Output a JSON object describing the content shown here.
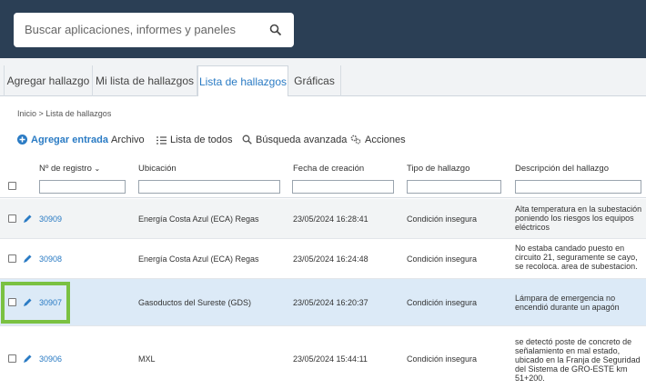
{
  "search": {
    "placeholder": "Buscar aplicaciones, informes y paneles",
    "icon": "search-icon"
  },
  "tabs": [
    {
      "label": "Agregar hallazgo",
      "active": false
    },
    {
      "label": "Mi lista de hallazgos",
      "active": false
    },
    {
      "label": "Lista de hallazgos",
      "active": true
    },
    {
      "label": "Gráficas",
      "active": false
    }
  ],
  "breadcrumb": "Inicio > Lista de hallazgos",
  "toolbar": {
    "add_label": "Agregar entrada",
    "archive_label": "Archivo",
    "list_all_label": "Lista de todos",
    "advanced_search_label": "Búsqueda avanzada",
    "actions_label": "Acciones"
  },
  "columns": {
    "registro": "Nº de registro",
    "ubicacion": "Ubicación",
    "fecha": "Fecha de creación",
    "tipo": "Tipo de hallazgo",
    "descripcion": "Descripción del hallazgo"
  },
  "rows": [
    {
      "id": "30909",
      "ubicacion": "Energía Costa Azul (ECA) Regas",
      "fecha": "23/05/2024 16:28:41",
      "tipo": "Condición insegura",
      "descripcion": "Alta temperatura en la subestación poniendo los riesgos los equipos eléctricos"
    },
    {
      "id": "30908",
      "ubicacion": "Energía Costa Azul (ECA) Regas",
      "fecha": "23/05/2024 16:24:48",
      "tipo": "Condición insegura",
      "descripcion": "No estaba candado puesto en circuito 21, seguramente se cayo, se recoloca. area de subestacion."
    },
    {
      "id": "30907",
      "ubicacion": "Gasoductos del Sureste (GDS)",
      "fecha": "23/05/2024 16:20:37",
      "tipo": "Condición insegura",
      "descripcion": "Lámpara de emergencia no encendió durante un apagón"
    },
    {
      "id": "30906",
      "ubicacion": "MXL",
      "fecha": "23/05/2024 15:44:11",
      "tipo": "Condición insegura",
      "descripcion": "se detectó poste de concreto de señalamiento en mal estado, ubicado en la Franja de Seguridad del Sistema de GRO-ESTE km 51+200."
    }
  ],
  "colors": {
    "topbar": "#2b3f55",
    "accent": "#2a7bc4",
    "selected_row": "#dceaf7",
    "highlight": "#7ac142"
  }
}
